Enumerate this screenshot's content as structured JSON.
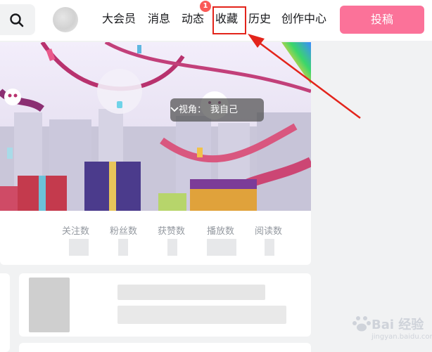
{
  "header": {
    "nav": [
      {
        "label": "大会员"
      },
      {
        "label": "消息"
      },
      {
        "label": "动态"
      },
      {
        "label": "收藏"
      },
      {
        "label": "历史"
      },
      {
        "label": "创作中心"
      }
    ],
    "dynamic_badge": "1",
    "upload_label": "投稿",
    "accent_color": "#fb7299"
  },
  "banner": {
    "view_label": "视角：",
    "view_value": "我自己"
  },
  "stats": [
    {
      "label": "关注数"
    },
    {
      "label": "粉丝数"
    },
    {
      "label": "获赞数"
    },
    {
      "label": "播放数"
    },
    {
      "label": "阅读数"
    }
  ],
  "annotation": {
    "color": "#e3241b"
  },
  "watermark": {
    "text": "Bai 经验",
    "url": "jingyan.baidu.com"
  }
}
